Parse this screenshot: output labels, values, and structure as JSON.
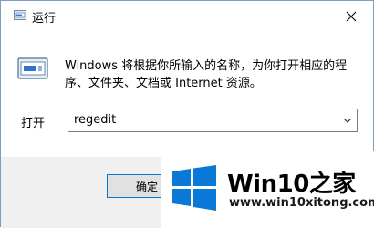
{
  "window": {
    "title": "运行",
    "close_icon": "close-icon"
  },
  "dialog": {
    "description": "Windows 将根据你所输入的名称，为你打开相应的程序、文件夹、文档或 Internet 资源。",
    "open_label": "打开",
    "command_value": "regedit",
    "ok_label": "确定"
  },
  "watermark": {
    "brand": "Win10之家",
    "url": "www.win10xitong.com",
    "colors": {
      "logo_blue": "#0a78d7"
    }
  }
}
